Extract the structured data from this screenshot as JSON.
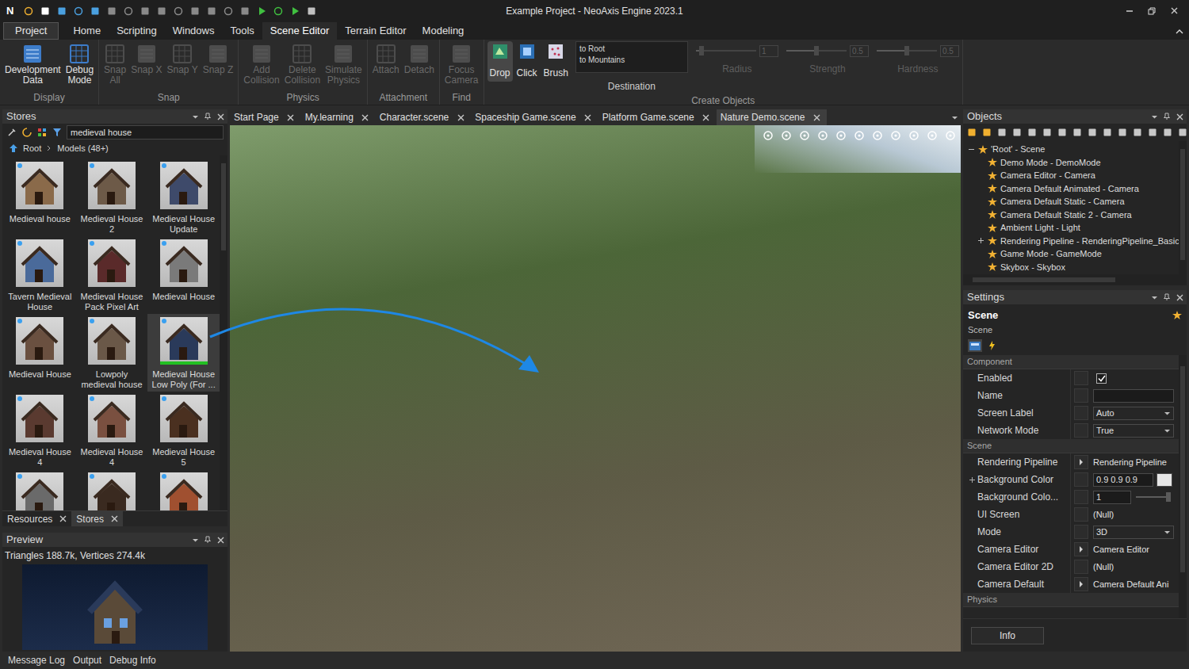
{
  "window": {
    "title": "Example Project - NeoAxis Engine 2023.1",
    "logo": "N"
  },
  "menu": [
    {
      "label": "Project",
      "kind": "backstage",
      "selected": false
    },
    {
      "label": "Home",
      "kind": "tab",
      "selected": false
    },
    {
      "label": "Scripting",
      "kind": "tab",
      "selected": false
    },
    {
      "label": "Windows",
      "kind": "tab",
      "selected": false
    },
    {
      "label": "Tools",
      "kind": "tab",
      "selected": false
    },
    {
      "label": "Scene Editor",
      "kind": "tab",
      "selected": true
    },
    {
      "label": "Terrain Editor",
      "kind": "tab",
      "selected": false
    },
    {
      "label": "Modeling",
      "kind": "tab",
      "selected": false
    }
  ],
  "ribbon": {
    "groups": [
      {
        "label": "Display",
        "buttons": [
          {
            "label": "Development Data",
            "disabled": false
          },
          {
            "label": "Debug Mode",
            "disabled": false
          }
        ]
      },
      {
        "label": "Snap",
        "buttons": [
          {
            "label": "Snap All",
            "disabled": true
          },
          {
            "label": "Snap X",
            "disabled": true
          },
          {
            "label": "Snap Y",
            "disabled": true
          },
          {
            "label": "Snap Z",
            "disabled": true
          }
        ]
      },
      {
        "label": "Physics",
        "buttons": [
          {
            "label": "Add Collision",
            "disabled": true
          },
          {
            "label": "Delete Collision",
            "disabled": true
          },
          {
            "label": "Simulate Physics",
            "disabled": true
          }
        ]
      },
      {
        "label": "Attachment",
        "buttons": [
          {
            "label": "Attach",
            "disabled": true
          },
          {
            "label": "Detach",
            "disabled": true
          }
        ]
      },
      {
        "label": "Find",
        "buttons": [
          {
            "label": "Focus Camera",
            "disabled": true
          }
        ]
      }
    ],
    "create_objects": {
      "label": "Create Objects",
      "modes": [
        {
          "label": "Drop",
          "selected": true
        },
        {
          "label": "Click",
          "selected": false
        },
        {
          "label": "Brush",
          "selected": false
        }
      ],
      "destination": {
        "label": "Destination",
        "options": [
          "to Root",
          "to Mountains"
        ]
      },
      "sliders": [
        {
          "label": "Radius",
          "value": "1",
          "level": 0.1,
          "disabled": true
        },
        {
          "label": "Strength",
          "value": "0.5",
          "level": 0.5,
          "disabled": true
        },
        {
          "label": "Hardness",
          "value": "0.5",
          "level": 0.5,
          "disabled": true
        }
      ]
    }
  },
  "stores": {
    "title": "Stores",
    "search": {
      "value": "medieval house"
    },
    "breadcrumb": [
      "Root",
      "Models (48+)"
    ],
    "items": [
      {
        "label": "Medieval house",
        "selected": false,
        "installed": false
      },
      {
        "label": "Medieval House 2",
        "selected": false,
        "installed": false
      },
      {
        "label": "Medieval House Update",
        "selected": false,
        "installed": false
      },
      {
        "label": "Tavern Medieval House",
        "selected": false,
        "installed": false
      },
      {
        "label": "Medieval House Pack Pixel Art",
        "selected": false,
        "installed": false
      },
      {
        "label": "Medieval House",
        "selected": false,
        "installed": false
      },
      {
        "label": "Medieval House",
        "selected": false,
        "installed": false
      },
      {
        "label": "Lowpoly medieval house",
        "selected": false,
        "installed": false
      },
      {
        "label": "Medieval House Low Poly (For ...",
        "selected": true,
        "installed": true
      },
      {
        "label": "Medieval House 4",
        "selected": false,
        "installed": false
      },
      {
        "label": "Medieval House 4",
        "selected": false,
        "installed": false
      },
      {
        "label": "Medieval House 5",
        "selected": false,
        "installed": false
      },
      {
        "label": "",
        "selected": false,
        "installed": false
      },
      {
        "label": "",
        "selected": false,
        "installed": false
      },
      {
        "label": "",
        "selected": false,
        "installed": false
      }
    ],
    "tabs": [
      {
        "label": "Resources",
        "selected": false
      },
      {
        "label": "Stores",
        "selected": true
      }
    ]
  },
  "preview": {
    "title": "Preview",
    "stats": "Triangles 188.7k, Vertices 274.4k"
  },
  "documents": [
    {
      "label": "Start Page",
      "selected": false
    },
    {
      "label": "My.learning",
      "selected": false
    },
    {
      "label": "Character.scene",
      "selected": false
    },
    {
      "label": "Spaceship Game.scene",
      "selected": false
    },
    {
      "label": "Platform Game.scene",
      "selected": false
    },
    {
      "label": "Nature Demo.scene",
      "selected": true
    }
  ],
  "objects": {
    "title": "Objects",
    "tree": [
      {
        "label": "'Root' - Scene",
        "depth": 0,
        "expandable": true,
        "expanded": true
      },
      {
        "label": "Demo Mode - DemoMode",
        "depth": 1,
        "expandable": false,
        "expanded": false
      },
      {
        "label": "Camera Editor - Camera",
        "depth": 1,
        "expandable": false,
        "expanded": false
      },
      {
        "label": "Camera Default Animated - Camera",
        "depth": 1,
        "expandable": false,
        "expanded": false
      },
      {
        "label": "Camera Default Static - Camera",
        "depth": 1,
        "expandable": false,
        "expanded": false
      },
      {
        "label": "Camera Default Static 2 - Camera",
        "depth": 1,
        "expandable": false,
        "expanded": false
      },
      {
        "label": "Ambient Light - Light",
        "depth": 1,
        "expandable": false,
        "expanded": false
      },
      {
        "label": "Rendering Pipeline - RenderingPipeline_Basic",
        "depth": 1,
        "expandable": true,
        "expanded": false
      },
      {
        "label": "Game Mode - GameMode",
        "depth": 1,
        "expandable": false,
        "expanded": false
      },
      {
        "label": "Skybox - Skybox",
        "depth": 1,
        "expandable": false,
        "expanded": false
      }
    ]
  },
  "settings": {
    "title": "Settings",
    "heading": "Scene",
    "subheading": "Scene",
    "sections": [
      {
        "label": "Component",
        "rows": [
          {
            "label": "Enabled",
            "kind": "checkbox",
            "checked": true,
            "expandable": false
          },
          {
            "label": "Name",
            "kind": "text",
            "value": "",
            "expandable": false
          },
          {
            "label": "Screen Label",
            "kind": "dropdown",
            "value": "Auto",
            "expandable": false
          },
          {
            "label": "Network Mode",
            "kind": "dropdown",
            "value": "True",
            "expandable": false
          }
        ]
      },
      {
        "label": "Scene",
        "rows": [
          {
            "label": "Rendering Pipeline",
            "kind": "link",
            "value": "Rendering Pipeline",
            "expandable": false
          },
          {
            "label": "Background Color",
            "kind": "color",
            "value": "0.9 0.9 0.9",
            "color": "#e6e6e6",
            "expandable": true
          },
          {
            "label": "Background Colo...",
            "kind": "slider",
            "value": "1",
            "level": 1,
            "expandable": false
          },
          {
            "label": "UI Screen",
            "kind": "ref",
            "value": "(Null)",
            "expandable": false
          },
          {
            "label": "Mode",
            "kind": "dropdown",
            "value": "3D",
            "expandable": false
          },
          {
            "label": "Camera Editor",
            "kind": "link",
            "value": "Camera Editor",
            "expandable": false
          },
          {
            "label": "Camera Editor 2D",
            "kind": "ref",
            "value": "(Null)",
            "expandable": false
          },
          {
            "label": "Camera Default",
            "kind": "link",
            "value": "Camera Default Ani",
            "expandable": false
          }
        ]
      },
      {
        "label": "Physics",
        "rows": []
      }
    ],
    "button": "Info"
  },
  "status_bar": [
    "Message Log",
    "Output",
    "Debug Info"
  ]
}
